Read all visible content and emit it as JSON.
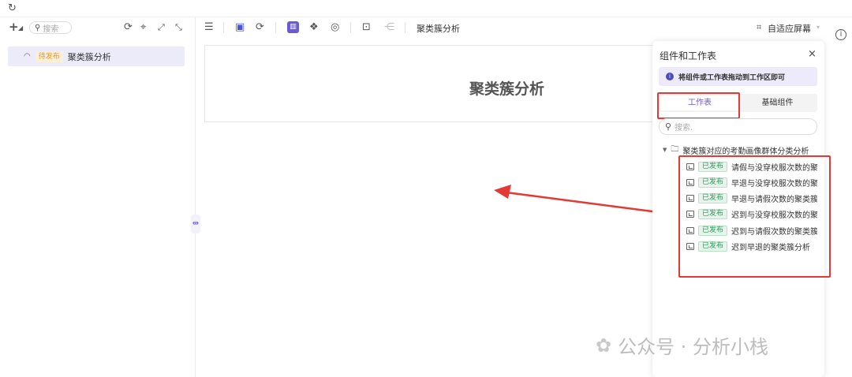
{
  "left": {
    "search_placeholder": "搜索",
    "item": {
      "status": "待发布",
      "label": "聚类簇分析"
    }
  },
  "toolbar": {
    "title": "聚类簇分析",
    "fit_screen_label": "自适应屏幕"
  },
  "canvas": {
    "title": "聚类簇分析"
  },
  "panel": {
    "title": "组件和工作表",
    "hint": "将组件或工作表拖动到工作区即可",
    "tabs": [
      "工作表",
      "基础组件"
    ],
    "search_placeholder": "搜索.",
    "folder": "聚类簇对应的考勤画像群体分类分析",
    "items": [
      {
        "status": "已发布",
        "label": "请假与没穿校服次数的聚类"
      },
      {
        "status": "已发布",
        "label": "早退与没穿校服次数的聚类"
      },
      {
        "status": "已发布",
        "label": "早退与请假次数的聚类簇分"
      },
      {
        "status": "已发布",
        "label": "迟到与没穿校服次数的聚类"
      },
      {
        "status": "已发布",
        "label": "迟到与请假次数的聚类簇分"
      },
      {
        "status": "已发布",
        "label": "迟到早退的聚类簇分析"
      }
    ]
  },
  "watermark": "公众号 · 分析小栈",
  "colors": {
    "accent": "#6b5bd2",
    "highlight_red": "#e53935",
    "published_green": "#2f9a5a",
    "pending_orange": "#e89a3c"
  }
}
